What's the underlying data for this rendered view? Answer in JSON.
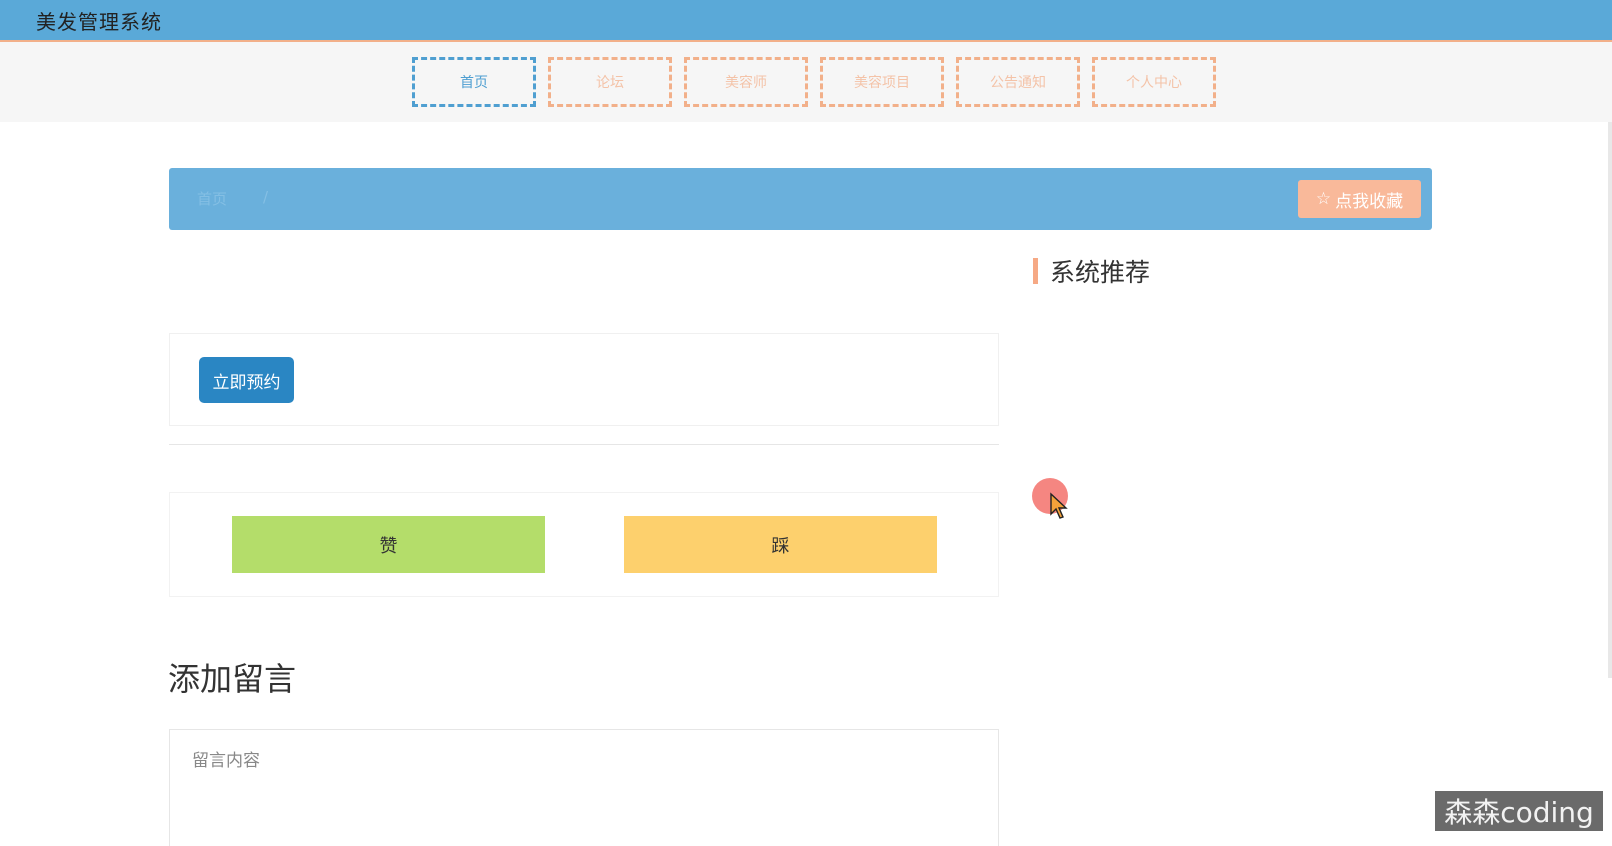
{
  "header": {
    "app_title": "美发管理系统"
  },
  "nav": {
    "items": [
      {
        "label": "首页",
        "active": true
      },
      {
        "label": "论坛",
        "active": false
      },
      {
        "label": "美容师",
        "active": false
      },
      {
        "label": "美容项目",
        "active": false
      },
      {
        "label": "公告通知",
        "active": false
      },
      {
        "label": "个人中心",
        "active": false
      }
    ]
  },
  "breadcrumb": {
    "home": "首页",
    "separator": "/"
  },
  "favorite": {
    "label": "点我收藏",
    "icon": "star-outline-icon"
  },
  "sidebar": {
    "title": "系统推荐"
  },
  "booking": {
    "button_label": "立即预约"
  },
  "vote": {
    "like_label": "赞",
    "dislike_label": "踩"
  },
  "comment": {
    "title": "添加留言",
    "placeholder": "留言内容"
  },
  "watermark": {
    "text": "森森coding"
  },
  "colors": {
    "header_blue": "#5aa9d8",
    "crumb_blue": "#6ab0dc",
    "accent_peach": "#f2b08a",
    "primary_button": "#2a86c3",
    "like_green": "#b4dd6a",
    "dislike_yellow": "#fdd06d"
  }
}
